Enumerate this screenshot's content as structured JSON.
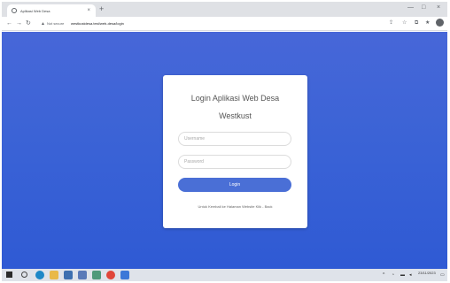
{
  "browser": {
    "tab_title": "Aplikasi Web Desa",
    "tab_close": "×",
    "new_tab": "+",
    "minimize": "—",
    "close": "×",
    "back": "←",
    "forward": "→",
    "reload": "↻",
    "security_label": "Not secure",
    "url": "westkustdesa.test/web-desa/login"
  },
  "page": {
    "title_line1": "Login Aplikasi Web Desa",
    "title_line2": "Westkust",
    "username_placeholder": "Username",
    "password_placeholder": "Password",
    "login_label": "Login",
    "footer": "Untuk Kembali ke Halaman Website Klik - Back"
  },
  "taskbar": {
    "date": "23/11/2023"
  },
  "colors": {
    "background_top": "#4767d8",
    "background_bottom": "#2f5ad4",
    "button": "#4a6fd6"
  }
}
